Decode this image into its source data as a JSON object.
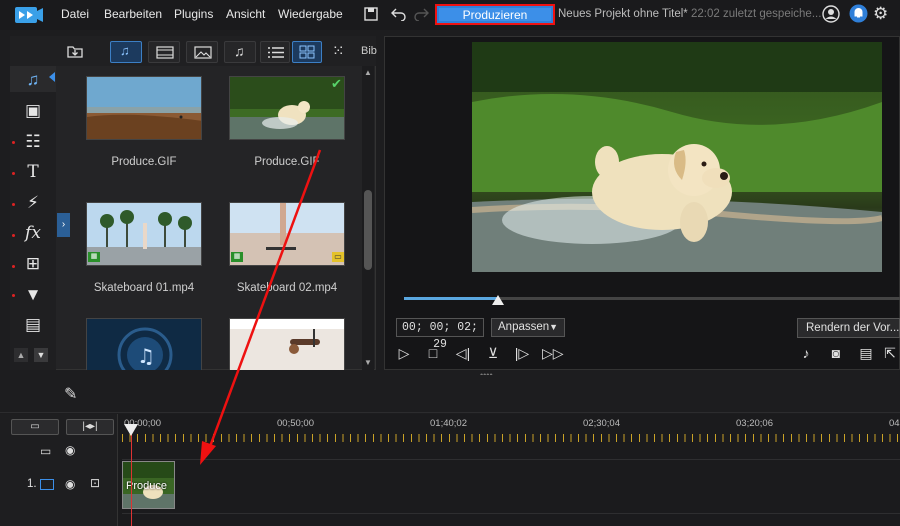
{
  "menubar": {
    "items": [
      "Datei",
      "Bearbeiten",
      "Plugins",
      "Ansicht",
      "Wiedergabe"
    ],
    "produce_label": "Produzieren",
    "project_title": "Neues Projekt ohne Titel*",
    "saved_info": "22:02 zuletzt gespeiche..."
  },
  "library": {
    "label": "Bib",
    "media": [
      {
        "name": "Produce.GIF",
        "kind": "beach"
      },
      {
        "name": "Produce.GIF",
        "kind": "dog",
        "checked": true
      },
      {
        "name": "Skateboard 01.mp4",
        "kind": "palms"
      },
      {
        "name": "Skateboard 02.mp4",
        "kind": "skate"
      },
      {
        "name": "",
        "kind": "music"
      },
      {
        "name": "",
        "kind": "gym"
      }
    ]
  },
  "preview": {
    "timecode": "00; 00; 02; 29",
    "fit_label": "Anpassen",
    "render_label": "Rendern der Vor...",
    "progress": 0.19
  },
  "timeline": {
    "ruler": [
      "00;00;00",
      "00;50;00",
      "01;40;02",
      "02;30;04",
      "03;20;06",
      "04"
    ],
    "track_number": "1.",
    "clip_label": "Produce"
  },
  "colors": {
    "accent": "#3c8fe8",
    "highlight": "#e11111",
    "ruler_ticks": "#c9a227"
  }
}
